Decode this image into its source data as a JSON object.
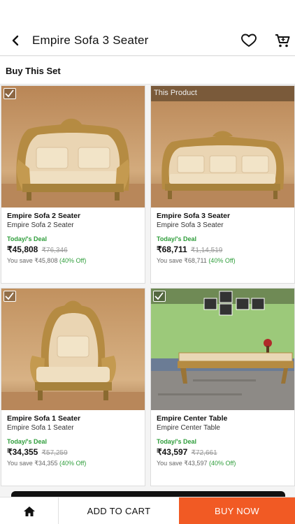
{
  "header": {
    "title": "Empire Sofa 3 Seater"
  },
  "section": {
    "title": "Buy This Set"
  },
  "products": [
    {
      "tag": "",
      "name": "Empire  Sofa 2 Seater",
      "subtitle": "Empire  Sofa 2 Seater",
      "deal": "Today/'s Deal",
      "price": "₹45,808",
      "mrp": "₹76,346",
      "save_prefix": "You save ₹45,808",
      "off": "(40% Off)"
    },
    {
      "tag": "This Product",
      "name": "Empire Sofa 3 Seater",
      "subtitle": "Empire Sofa 3 Seater",
      "deal": "Today/'s Deal",
      "price": "₹68,711",
      "mrp": "₹1,14,519",
      "save_prefix": "You save ₹68,711",
      "off": "(40% Off)"
    },
    {
      "tag": "",
      "name": "Empire Sofa 1 Seater",
      "subtitle": "Empire Sofa 1 Seater",
      "deal": "Today/'s Deal",
      "price": "₹34,355",
      "mrp": "₹57,259",
      "save_prefix": "You save ₹34,355",
      "off": "(40% Off)"
    },
    {
      "tag": "",
      "name": "Empire Center Table",
      "subtitle": "Empire Center Table",
      "deal": "Today/'s Deal",
      "price": "₹43,597",
      "mrp": "₹72,661",
      "save_prefix": "You save ₹43,597",
      "off": "(40% Off)"
    }
  ],
  "bottom": {
    "add_to_cart": "ADD TO CART",
    "buy_now": "BUY NOW"
  },
  "icons": {
    "back": "back-arrow-icon",
    "wishlist": "heart-icon",
    "cart": "cart-icon",
    "home": "home-icon",
    "checkbox": "checkbox-icon"
  },
  "colors": {
    "accent": "#f15a24",
    "deal_green": "#2e9d3a"
  }
}
